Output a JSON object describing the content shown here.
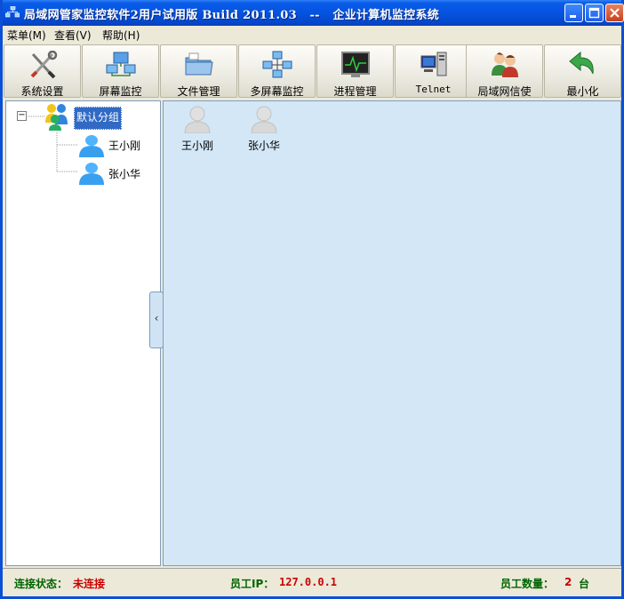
{
  "window": {
    "title": "局域网管家监控软件2用户试用版 Build 2011.03   --   企业计算机监控系统"
  },
  "menu": {
    "items": [
      "菜单(M)",
      "查看(V)",
      "帮助(H)"
    ]
  },
  "toolbar": {
    "items": [
      {
        "label": "系统设置",
        "icon": "wrench-screwdriver-icon"
      },
      {
        "label": "屏幕监控",
        "icon": "monitor-network-icon"
      },
      {
        "label": "文件管理",
        "icon": "folder-icon"
      },
      {
        "label": "多屏幕监控",
        "icon": "multi-screen-icon"
      },
      {
        "label": "进程管理",
        "icon": "process-monitor-icon"
      },
      {
        "label": "Telnet",
        "icon": "telnet-computer-icon"
      },
      {
        "label": "局域网信使",
        "icon": "messenger-users-icon"
      },
      {
        "label": "最小化",
        "icon": "minimize-arrow-icon"
      }
    ]
  },
  "tree": {
    "group_label": "默认分组",
    "toggle": "−",
    "children": [
      "王小刚",
      "张小华"
    ]
  },
  "collapse_glyph": "‹",
  "content": {
    "users": [
      "王小刚",
      "张小华"
    ]
  },
  "status": {
    "connection_label": "连接状态：",
    "connection_value": "未连接",
    "ip_label": "员工IP：",
    "ip_value": "127.0.0.1",
    "count_label": "员工数量：",
    "count_value": "2",
    "count_unit": "台"
  },
  "colors": {
    "title_bar": "#0553e0",
    "status_label": "#006400",
    "status_value": "#cc0000",
    "content_bg": "#d3e7f7"
  }
}
